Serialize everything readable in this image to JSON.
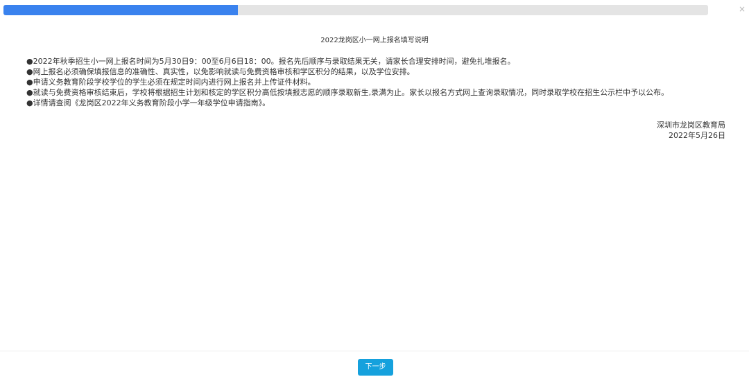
{
  "progress": {
    "value_fraction": 0.333,
    "fill_color": "#3a82ee",
    "track_color": "#e4e4e4"
  },
  "close": {
    "icon": "close-icon",
    "glyph": "×"
  },
  "document": {
    "title": "2022龙岗区小一网上报名填写说明",
    "items": [
      "●2022年秋季招生小一网上报名时间为5月30日9：00至6月6日18：00。报名先后顺序与录取结果无关，请家长合理安排时间，避免扎堆报名。",
      "●网上报名必须确保填报信息的准确性、真实性，以免影响就读与免费资格审核和学区积分的结果，以及学位安排。",
      "●申请义务教育阶段学校学位的学生必须在规定时间内进行网上报名并上传证件材料。",
      "●就读与免费资格审核结束后，学校将根据招生计划和核定的学区积分高低按填报志愿的顺序录取新生,录满为止。家长以报名方式网上查询录取情况，同时录取学校在招生公示栏中予以公布。",
      "●详情请查阅《龙岗区2022年义务教育阶段小学一年级学位申请指南》。"
    ],
    "signature": {
      "issuer": "深圳市龙岗区教育局",
      "date": "2022年5月26日"
    }
  },
  "footer": {
    "next_label": "下一步",
    "button_color": "#15a1dd"
  }
}
